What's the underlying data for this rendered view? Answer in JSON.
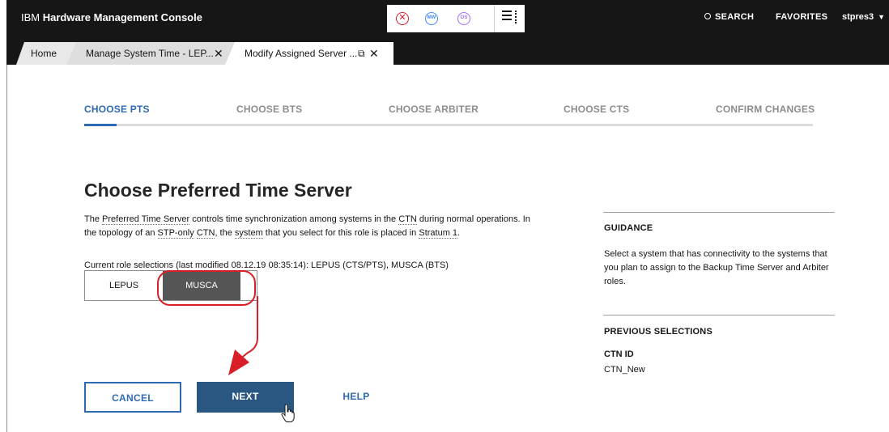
{
  "header": {
    "brand": "IBM",
    "app_name": "Hardware Management Console",
    "status_icons": [
      {
        "name": "error-icon",
        "symbol": "✕",
        "color": "#da1e28"
      },
      {
        "name": "mw-icon",
        "symbol": "MW",
        "color": "#4589ff"
      },
      {
        "name": "os-icon",
        "symbol": "OS",
        "color": "#a56eff"
      }
    ],
    "search_label": "SEARCH",
    "favorites_label": "FAVORITES",
    "user": "stpres3"
  },
  "tabs": [
    {
      "label": "Home"
    },
    {
      "label": "Manage System Time - LEP..."
    },
    {
      "label": "Modify Assigned Server ..."
    }
  ],
  "steps": [
    {
      "label": "CHOOSE PTS",
      "active": true
    },
    {
      "label": "CHOOSE BTS",
      "active": false
    },
    {
      "label": "CHOOSE ARBITER",
      "active": false
    },
    {
      "label": "CHOOSE CTS",
      "active": false
    },
    {
      "label": "CONFIRM CHANGES",
      "active": false
    }
  ],
  "main": {
    "title": "Choose Preferred Time Server",
    "desc_parts": [
      "The ",
      "Preferred Time Server",
      " controls time synchronization among systems in the ",
      "CTN",
      " during normal operations. In the topology of an ",
      "STP-only",
      " ",
      "CTN",
      ", the ",
      "system",
      " that you select for this role is placed in ",
      "Stratum 1",
      "."
    ],
    "current_roles": "Current role selections (last modified 08.12.19 08:35:14): LEPUS (CTS/PTS), MUSCA (BTS)",
    "systems": [
      {
        "label": "LEPUS",
        "selected": false
      },
      {
        "label": "MUSCA",
        "selected": true
      }
    ],
    "buttons": {
      "cancel": "CANCEL",
      "next": "NEXT",
      "help": "HELP"
    }
  },
  "guidance": {
    "heading": "GUIDANCE",
    "text": "Select a system that has connectivity to the systems that you plan to assign to the Backup Time Server and Arbiter roles.",
    "previous_heading": "PREVIOUS SELECTIONS",
    "ctn_label": "CTN ID",
    "ctn_value": "CTN_New"
  },
  "colors": {
    "accent": "#2e6ab3",
    "primary_button": "#2a5782",
    "annotation": "#da1e28",
    "header_bg": "#161616"
  }
}
